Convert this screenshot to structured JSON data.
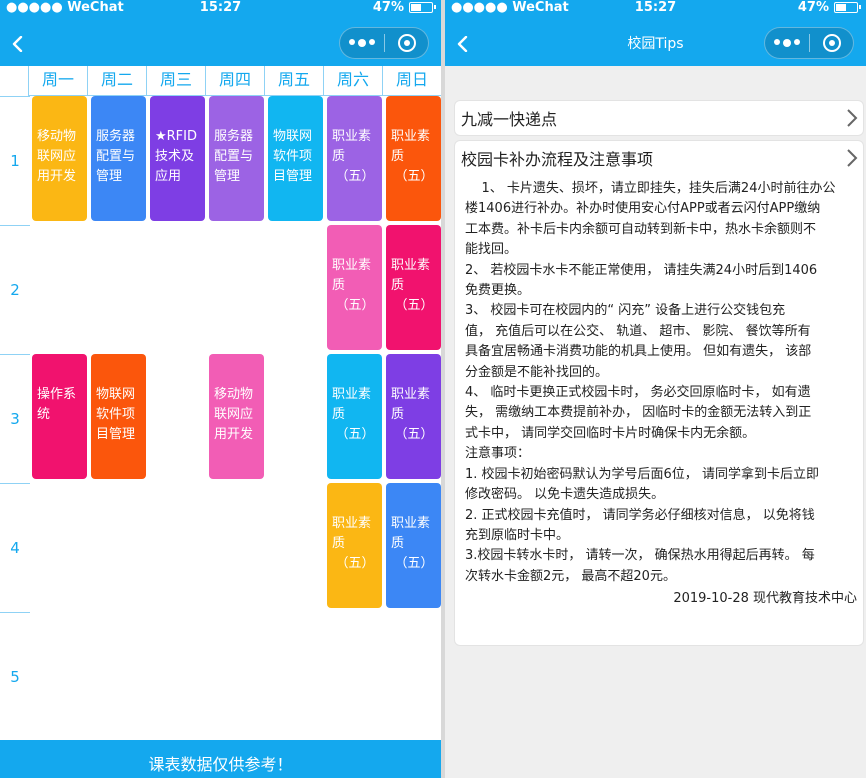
{
  "status_bar": {
    "carrier": "●●●●● WeChat",
    "time": "15:27",
    "battery": "47%"
  },
  "colors": {
    "brand": "#14a8ee",
    "header_text": "#14a8ee",
    "grid_line": "#8fd2f5"
  },
  "timetable": {
    "weekdays": [
      "周一",
      "周二",
      "周三",
      "周四",
      "周五",
      "周六",
      "周日"
    ],
    "periods": [
      "1",
      "2",
      "3",
      "4",
      "5"
    ],
    "courses": [
      {
        "day": 0,
        "period": 0,
        "lines": [
          "移动物",
          "联网应",
          "用开发"
        ],
        "color": "#fbb714"
      },
      {
        "day": 1,
        "period": 0,
        "lines": [
          "服务器",
          "配置与",
          "管理"
        ],
        "color": "#3c87f5"
      },
      {
        "day": 2,
        "period": 0,
        "lines": [
          "★RFID",
          "技术及",
          "应用"
        ],
        "color": "#7e3ee4"
      },
      {
        "day": 3,
        "period": 0,
        "lines": [
          "服务器",
          "配置与",
          "管理"
        ],
        "color": "#9c63e4"
      },
      {
        "day": 4,
        "period": 0,
        "lines": [
          "物联网",
          "软件项",
          "目管理"
        ],
        "color": "#11b6f1"
      },
      {
        "day": 5,
        "period": 0,
        "lines": [
          "职业素",
          "质",
          "（五）"
        ],
        "color": "#9c63e4"
      },
      {
        "day": 6,
        "period": 0,
        "lines": [
          "职业素",
          "质",
          "（五）"
        ],
        "color": "#fb560c"
      },
      {
        "day": 5,
        "period": 1,
        "lines": [
          "职业素",
          "质",
          "（五）"
        ],
        "color": "#f25db5"
      },
      {
        "day": 6,
        "period": 1,
        "lines": [
          "职业素",
          "质",
          "（五）"
        ],
        "color": "#f1126e"
      },
      {
        "day": 0,
        "period": 2,
        "lines": [
          "操作系",
          "统"
        ],
        "color": "#f1126e"
      },
      {
        "day": 1,
        "period": 2,
        "lines": [
          "物联网",
          "软件项",
          "目管理"
        ],
        "color": "#fb560c"
      },
      {
        "day": 3,
        "period": 2,
        "lines": [
          "移动物",
          "联网应",
          "用开发"
        ],
        "color": "#f25db5"
      },
      {
        "day": 5,
        "period": 2,
        "lines": [
          "职业素",
          "质",
          "（五）"
        ],
        "color": "#11b6f1"
      },
      {
        "day": 6,
        "period": 2,
        "lines": [
          "职业素",
          "质",
          "（五）"
        ],
        "color": "#7e3ee4"
      },
      {
        "day": 5,
        "period": 3,
        "lines": [
          "职业素",
          "质",
          "（五）"
        ],
        "color": "#fbb714"
      },
      {
        "day": 6,
        "period": 3,
        "lines": [
          "职业素",
          "质",
          "（五）"
        ],
        "color": "#3c87f5"
      }
    ],
    "footer": "课表数据仅供参考！"
  },
  "tips_page": {
    "title": "校园Tips",
    "card1_title": "九减一快递点",
    "card2_title": "校园卡补办流程及注意事项",
    "body_lines": [
      "    1、 卡片遗失、损坏，请立即挂失，挂失后满24小时前往办公",
      "楼1406进行补办。补办时使用安心付APP或者云闪付APP缴纳",
      "工本费。补卡后卡内余额可自动转到新卡中，热水卡余额则不",
      "能找回。",
      "2、 若校园卡水卡不能正常使用， 请挂失满24小时后到1406",
      "免费更换。",
      "3、 校园卡可在校园内的“ 闪充” 设备上进行公交钱包充",
      "值， 充值后可以在公交、 轨道、 超市、 影院、 餐饮等所有",
      "具备宜居畅通卡消费功能的机具上使用。 但如有遗失， 该部",
      "分金额是不能补找回的。",
      "4、 临时卡更换正式校园卡时， 务必交回原临时卡， 如有遗",
      "失， 需缴纳工本费提前补办， 因临时卡的金额无法转入到正",
      "式卡中， 请同学交回临时卡片时确保卡内无余额。",
      "注意事项：",
      "1. 校园卡初始密码默认为学号后面6位， 请同学拿到卡后立即",
      "修改密码。 以免卡遗失造成损失。",
      "2. 正式校园卡充值时， 请同学务必仔细核对信息， 以免将钱",
      "充到原临时卡中。",
      "3.校园卡转水卡时， 请转一次， 确保热水用得起后再转。 每",
      "次转水卡金额2元， 最高不超20元。"
    ],
    "signature": "2019-10-28 现代教育技术中心"
  }
}
